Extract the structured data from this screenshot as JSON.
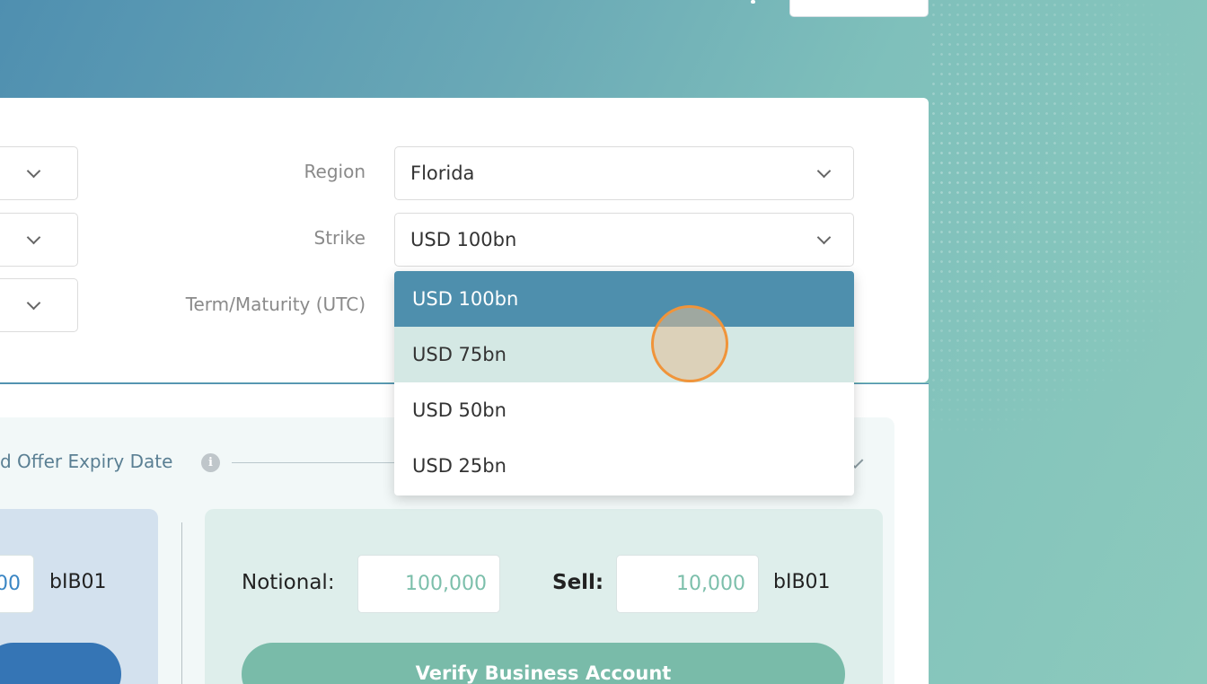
{
  "form": {
    "region": {
      "label": "Region",
      "value": "Florida"
    },
    "strike": {
      "label": "Strike",
      "value": "USD 100bn"
    },
    "term": {
      "label": "Term/Maturity (UTC)"
    }
  },
  "strike_dropdown": {
    "options": [
      "USD 100bn",
      "USD 75bn",
      "USD 50bn",
      "USD 25bn"
    ],
    "selected": "USD 100bn",
    "hovered": "USD 75bn"
  },
  "offer": {
    "expiry_label": "d Offer Expiry Date",
    "left": {
      "amount_partial": "00",
      "unit": "bIB01"
    },
    "right": {
      "notional_label": "Notional:",
      "notional_value": "100,000",
      "sell_label": "Sell:",
      "sell_value": "10,000",
      "unit": "bIB01",
      "verify_button": "Verify Business Account"
    }
  },
  "colors": {
    "selected_option": "#4e8fad",
    "hover_option": "#d4e8e4",
    "primary_button": "#3575b5",
    "verify_button": "#79bba9",
    "cursor_ring": "#f0943a"
  }
}
